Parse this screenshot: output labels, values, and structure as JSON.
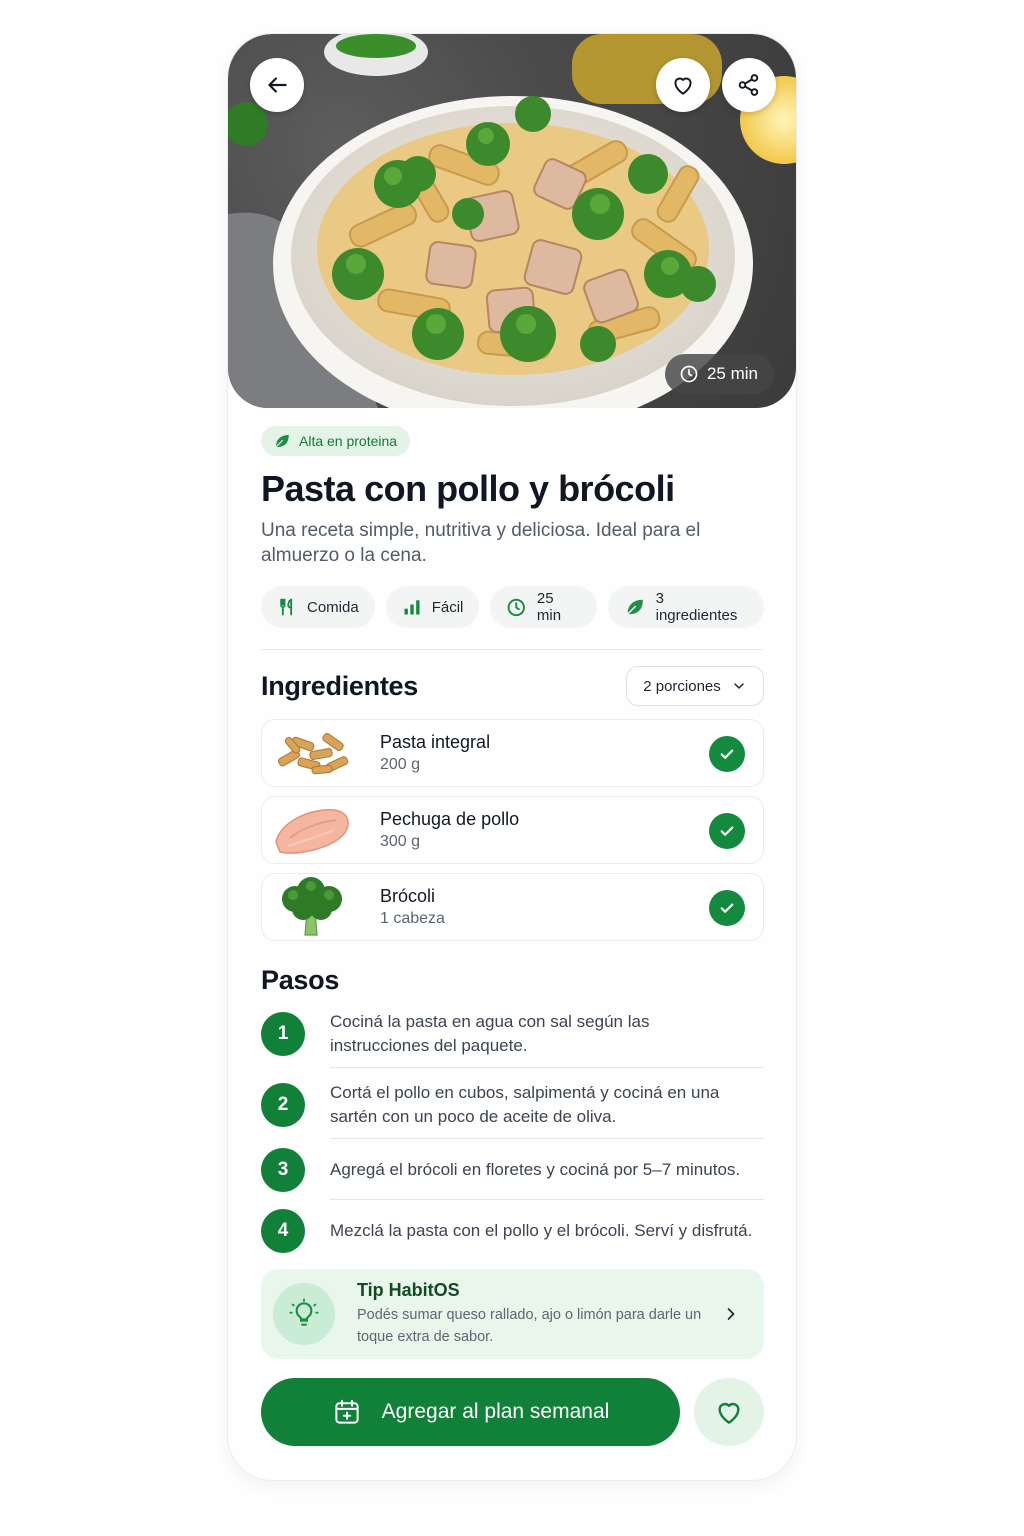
{
  "hero": {
    "time_label": "25 min",
    "icons": {
      "back": "arrow-left-icon",
      "favorite": "heart-icon",
      "share": "share-icon",
      "time": "clock-icon"
    }
  },
  "recipe": {
    "tag": "Alta en proteina",
    "title": "Pasta con pollo y brócoli",
    "description": "Una receta simple, nutritiva y deliciosa. Ideal para el almuerzo o la cena.",
    "chips": [
      {
        "label": "Comida",
        "icon": "utensils-icon"
      },
      {
        "label": "Fácil",
        "icon": "bar-chart-icon"
      },
      {
        "label": "25 min",
        "icon": "clock-icon"
      },
      {
        "label": "3 ingredientes",
        "icon": "leaf-icon"
      }
    ]
  },
  "ingredients": {
    "heading": "Ingredientes",
    "servings": "2 porciones",
    "items": [
      {
        "name": "Pasta integral",
        "qty": "200 g",
        "checked": true
      },
      {
        "name": "Pechuga de pollo",
        "qty": "300 g",
        "checked": true
      },
      {
        "name": "Brócoli",
        "qty": "1 cabeza",
        "checked": true
      }
    ]
  },
  "steps": {
    "heading": "Pasos",
    "items": [
      {
        "num": "1",
        "text": "Cociná la pasta en agua con sal según las instrucciones del paquete."
      },
      {
        "num": "2",
        "text": "Cortá el pollo en cubos, salpimentá y cociná en una sartén con un poco de aceite de oliva."
      },
      {
        "num": "3",
        "text": "Agregá el brócoli en floretes y cociná por 5–7 minutos."
      },
      {
        "num": "4",
        "text": "Mezclá la pasta con el pollo y el brócoli. Serví y disfrutá."
      }
    ]
  },
  "tip": {
    "title": "Tip HabitOS",
    "text": "Podés sumar queso rallado, ajo o limón para darle un toque extra de sabor."
  },
  "actions": {
    "primary": "Agregar al plan semanal"
  },
  "colors": {
    "accent": "#118038",
    "accent_light": "#e3f4e7"
  }
}
